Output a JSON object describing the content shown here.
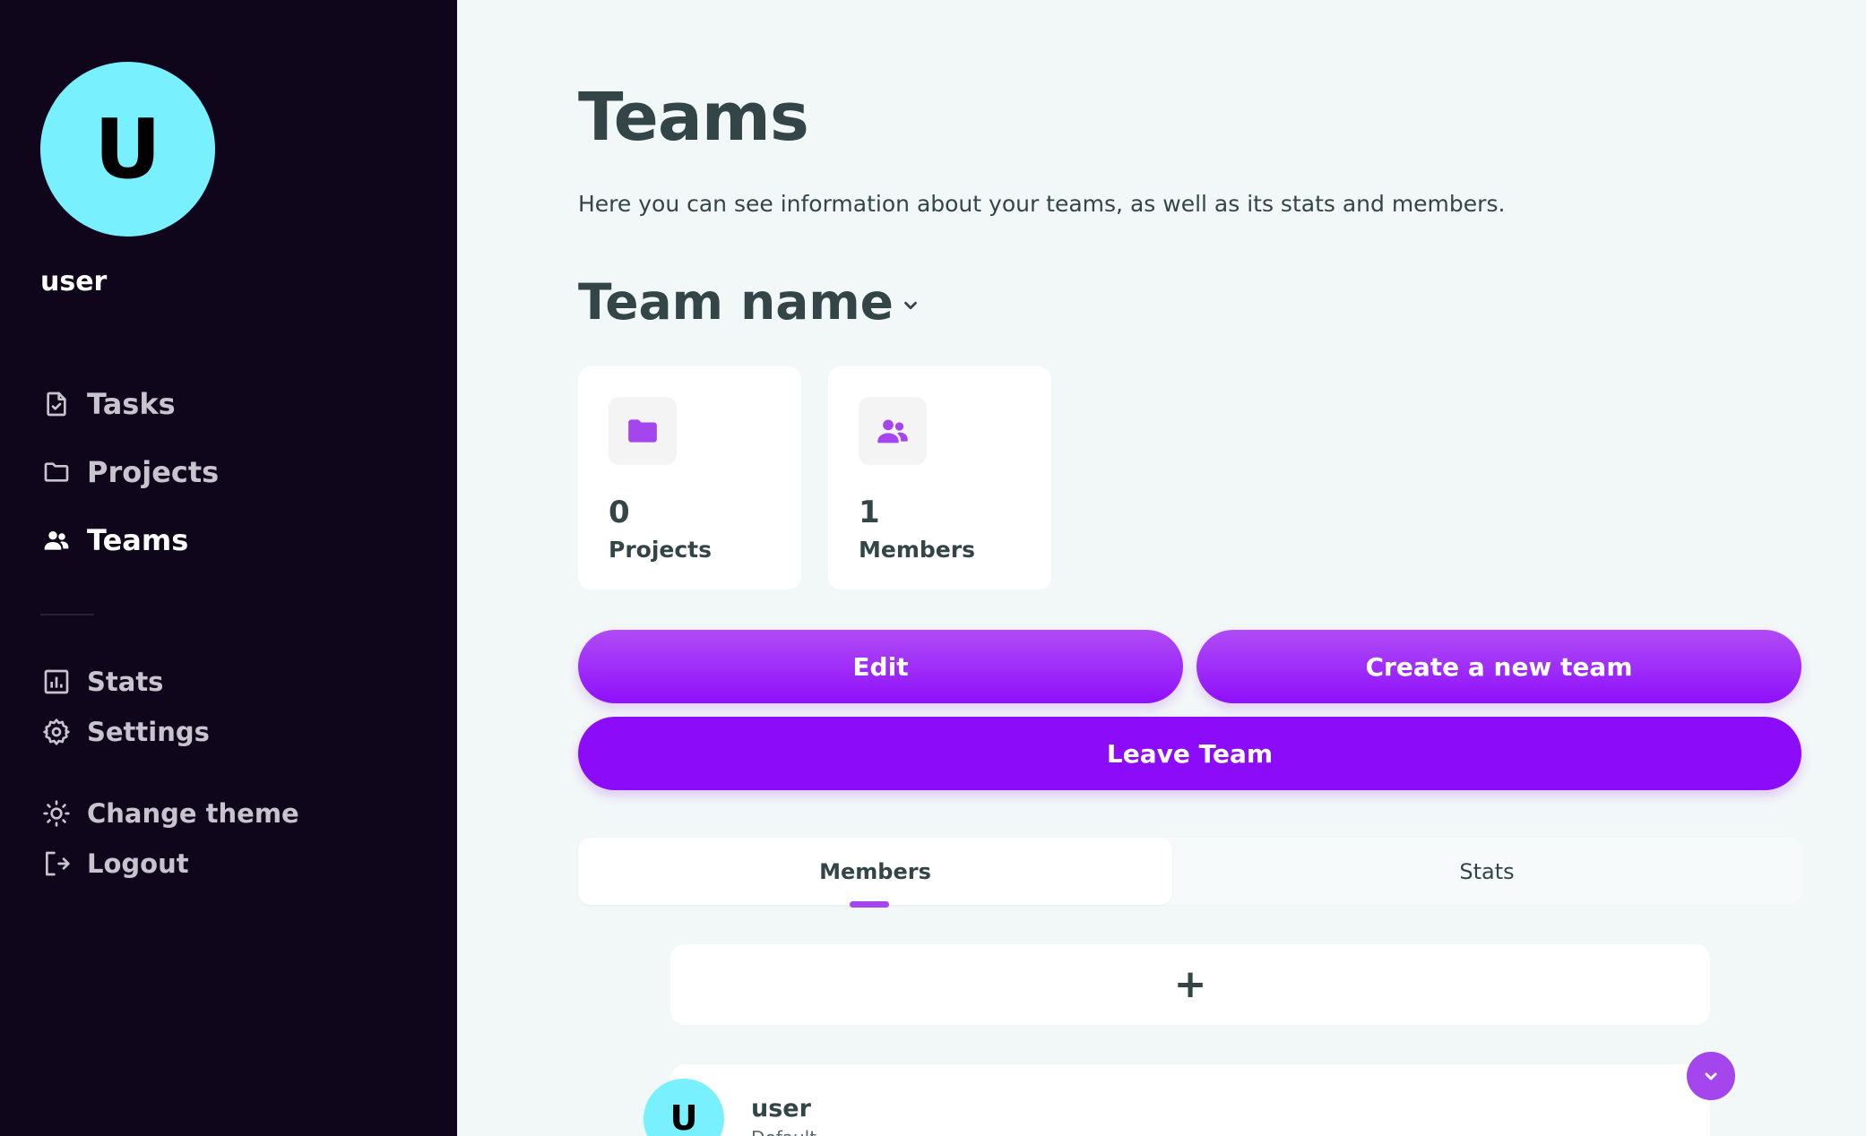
{
  "sidebar": {
    "avatar_initial": "U",
    "username": "user",
    "nav_primary": [
      {
        "label": "Tasks",
        "icon": "task-document-icon"
      },
      {
        "label": "Projects",
        "icon": "folder-icon"
      },
      {
        "label": "Teams",
        "icon": "people-icon",
        "active": true
      }
    ],
    "nav_secondary": [
      {
        "label": "Stats",
        "icon": "bar-chart-icon"
      },
      {
        "label": "Settings",
        "icon": "gear-icon"
      }
    ],
    "nav_tertiary": [
      {
        "label": "Change theme",
        "icon": "sun-icon"
      },
      {
        "label": "Logout",
        "icon": "logout-icon"
      }
    ]
  },
  "main": {
    "title": "Teams",
    "description": "Here you can see information about your teams, as well as its stats and members.",
    "team_name": "Team name",
    "stats": [
      {
        "value": "0",
        "label": "Projects",
        "icon": "folder-icon"
      },
      {
        "value": "1",
        "label": "Members",
        "icon": "people-icon"
      }
    ],
    "buttons": {
      "edit": "Edit",
      "create": "Create a new team",
      "leave": "Leave Team"
    },
    "tabs": [
      {
        "label": "Members",
        "active": true
      },
      {
        "label": "Stats",
        "active": false
      }
    ],
    "add_member_symbol": "+",
    "members": [
      {
        "initial": "U",
        "name": "user",
        "role": "Default"
      }
    ]
  },
  "colors": {
    "sidebar_bg": "#10061c",
    "accent": "#8c0cf9",
    "accent_light": "#a445ee",
    "avatar": "#79f0fd",
    "text_dark": "#344548",
    "page_bg": "#f2f7f7"
  }
}
